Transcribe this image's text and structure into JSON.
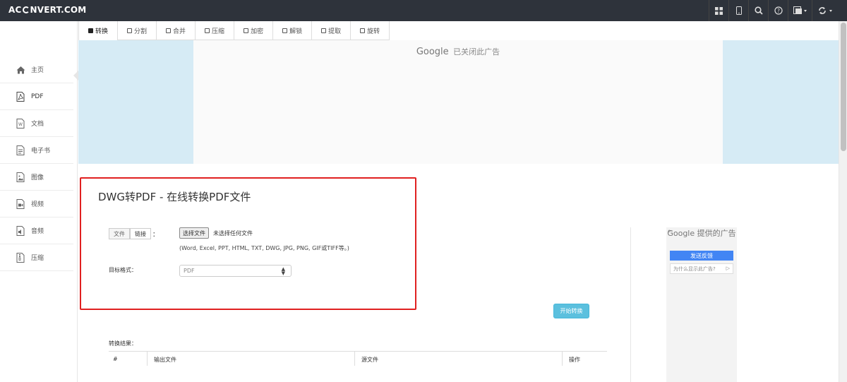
{
  "navbar": {
    "brand_pre": "AC",
    "brand_post": "NVERT.COM",
    "icons": [
      "grid-icon",
      "mobile-icon",
      "search-icon",
      "help-icon",
      "language-icon",
      "refresh-icon"
    ]
  },
  "sidebar": {
    "items": [
      {
        "label": "主页",
        "icon": "home-icon"
      },
      {
        "label": "PDF",
        "icon": "pdf-icon"
      },
      {
        "label": "文档",
        "icon": "document-icon"
      },
      {
        "label": "电子书",
        "icon": "ebook-icon"
      },
      {
        "label": "图像",
        "icon": "image-icon"
      },
      {
        "label": "视频",
        "icon": "video-icon"
      },
      {
        "label": "音频",
        "icon": "audio-icon"
      },
      {
        "label": "压缩",
        "icon": "archive-icon"
      }
    ],
    "active_index": 1
  },
  "tabs": [
    {
      "label": "转换",
      "active": true
    },
    {
      "label": "分割"
    },
    {
      "label": "合并"
    },
    {
      "label": "压缩"
    },
    {
      "label": "加密"
    },
    {
      "label": "解锁"
    },
    {
      "label": "提取"
    },
    {
      "label": "旋转"
    }
  ],
  "ad_banner": {
    "google": "Google",
    "closed_text": "已关闭此广告"
  },
  "form": {
    "title": "DWG转PDF - 在线转换PDF文件",
    "source_tabs": [
      "文件",
      "链接"
    ],
    "colon": "：",
    "choose_file": "选择文件",
    "no_file": "未选择任何文件",
    "formats_hint": "(Word, Excel, PPT, HTML, TXT, DWG, JPG, PNG, GIF或TIFF等。)",
    "target_label": "目标格式：",
    "target_value": "PDF",
    "start_button": "开始转换"
  },
  "results": {
    "label": "转换结果：",
    "columns": [
      "#",
      "输出文件",
      "源文件",
      "操作"
    ]
  },
  "side_ad": {
    "title_google": "Google",
    "title_rest": "提供的广告",
    "feedback": "发送反馈",
    "why": "为什么显示此广告?"
  },
  "colors": {
    "navbar": "#2e333b",
    "ad_blue": "#d6ebf5",
    "start_button": "#5bc0de",
    "highlight_box": "#e02020",
    "feedback_blue": "#4285f4"
  }
}
